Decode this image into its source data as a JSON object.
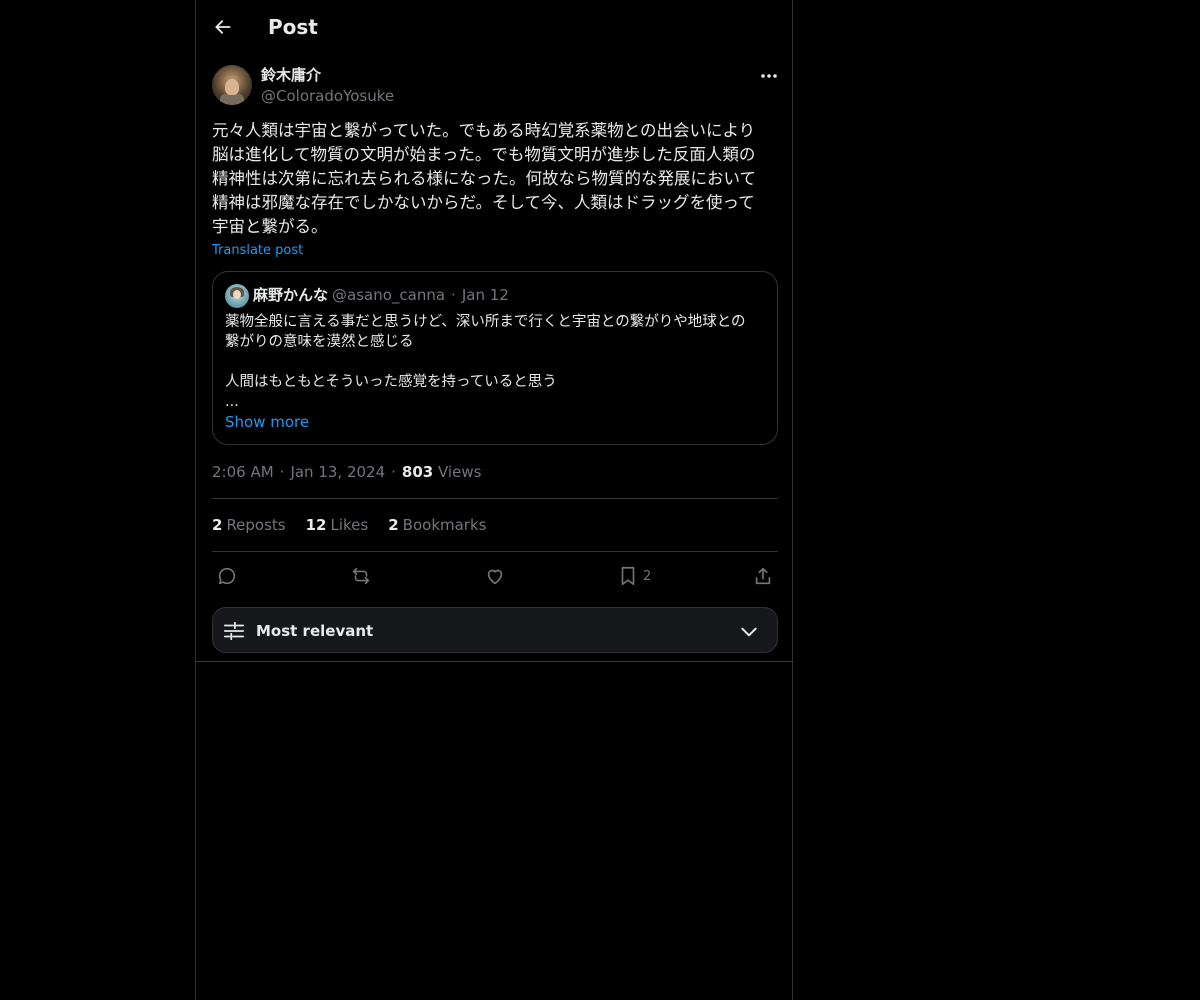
{
  "header": {
    "title": "Post",
    "back_icon": "arrow-left-icon"
  },
  "post": {
    "author_name": "鈴木庸介",
    "author_handle": "@ColoradoYosuke",
    "more_icon": "more-horizontal-icon",
    "text": "元々人類は宇宙と繋がっていた。でもある時幻覚系薬物との出会いにより\n脳は進化して物質の文明が始まった。でも物質文明が進歩した反面人類の\n精神性は次第に忘れ去られる様になった。何故なら物質的な発展において\n精神は邪魔な存在でしかないからだ。そして今、人類はドラッグを使って\n宇宙と繋がる。",
    "translate_label": "Translate post",
    "time": "2:06 AM",
    "date": "Jan 13, 2024",
    "views_count": "803",
    "views_label": "Views"
  },
  "quote": {
    "name": "麻野かんな",
    "handle": "@asano_canna",
    "dot": "·",
    "date": "Jan 12",
    "text": "薬物全般に言える事だと思うけど、深い所まで行くと宇宙との繋がりや地球との\n繋がりの意味を漠然と感じる\n\n人間はもともとそういった感覚を持っていると思う\n...",
    "show_more": "Show more"
  },
  "stats": {
    "reposts_count": "2",
    "reposts_label": "Reposts",
    "likes_count": "12",
    "likes_label": "Likes",
    "bookmarks_count": "2",
    "bookmarks_label": "Bookmarks"
  },
  "actions": {
    "reply_icon": "reply-icon",
    "repost_icon": "repost-icon",
    "like_icon": "heart-icon",
    "bookmark_icon": "bookmark-icon",
    "bookmark_count": "2",
    "share_icon": "share-icon"
  },
  "sort": {
    "label": "Most relevant",
    "icon": "sliders-icon",
    "chevron": "chevron-down-icon"
  },
  "separator": "·",
  "colors": {
    "background": "#000000",
    "text_primary": "#e7e9ea",
    "text_secondary": "#71767b",
    "accent": "#1d9bf0",
    "border": "#2f3336"
  }
}
